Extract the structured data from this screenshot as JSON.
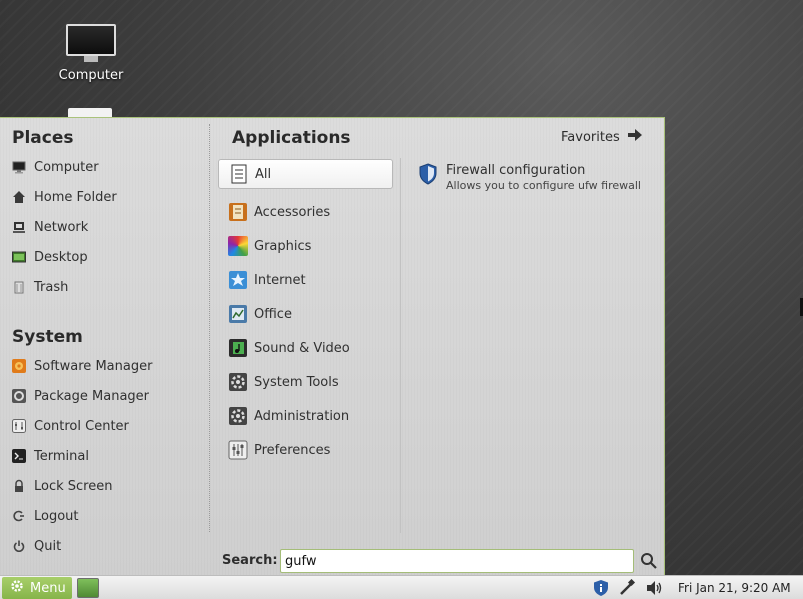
{
  "desktop": {
    "icons": [
      {
        "label": "Computer",
        "icon": "computer-monitor-icon"
      }
    ]
  },
  "menu": {
    "places": {
      "title": "Places",
      "items": [
        {
          "label": "Computer",
          "icon": "computer-icon"
        },
        {
          "label": "Home Folder",
          "icon": "home-icon"
        },
        {
          "label": "Network",
          "icon": "network-icon"
        },
        {
          "label": "Desktop",
          "icon": "desktop-icon"
        },
        {
          "label": "Trash",
          "icon": "trash-icon"
        }
      ]
    },
    "system": {
      "title": "System",
      "items": [
        {
          "label": "Software Manager",
          "icon": "software-manager-icon"
        },
        {
          "label": "Package Manager",
          "icon": "package-manager-icon"
        },
        {
          "label": "Control Center",
          "icon": "control-center-icon"
        },
        {
          "label": "Terminal",
          "icon": "terminal-icon"
        },
        {
          "label": "Lock Screen",
          "icon": "lock-icon"
        },
        {
          "label": "Logout",
          "icon": "logout-icon"
        },
        {
          "label": "Quit",
          "icon": "power-icon"
        }
      ]
    },
    "applications": {
      "title": "Applications",
      "favorites_label": "Favorites",
      "categories": [
        {
          "label": "All",
          "icon": "all-list-icon",
          "selected": true
        },
        {
          "label": "Accessories",
          "icon": "accessories-icon"
        },
        {
          "label": "Graphics",
          "icon": "graphics-icon"
        },
        {
          "label": "Internet",
          "icon": "internet-icon"
        },
        {
          "label": "Office",
          "icon": "office-icon"
        },
        {
          "label": "Sound & Video",
          "icon": "sound-video-icon"
        },
        {
          "label": "System Tools",
          "icon": "system-tools-icon"
        },
        {
          "label": "Administration",
          "icon": "administration-icon"
        },
        {
          "label": "Preferences",
          "icon": "preferences-icon"
        }
      ],
      "results": [
        {
          "name": "Firewall configuration",
          "description": "Allows you to configure ufw firewall",
          "icon": "shield-icon"
        }
      ]
    },
    "search": {
      "label": "Search:",
      "value": "gufw"
    }
  },
  "taskbar": {
    "menu_label": "Menu",
    "clock": "Fri Jan 21,  9:20 AM",
    "tray_icons": [
      "shield-update-icon",
      "network-cable-icon",
      "volume-icon"
    ]
  },
  "colors": {
    "accent_green": "#86b44a",
    "menu_border": "#a9c27a"
  }
}
